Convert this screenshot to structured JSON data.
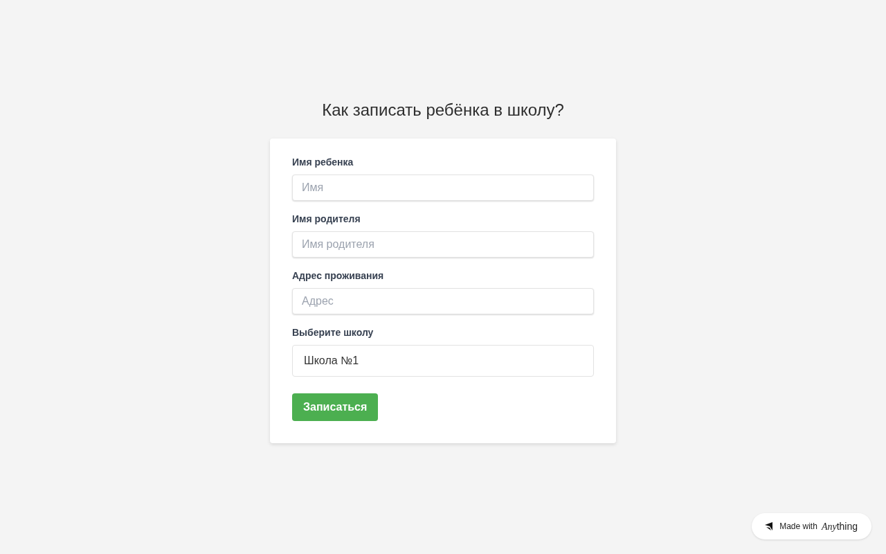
{
  "title": "Как записать ребёнка в школу?",
  "fields": [
    {
      "kind": "text",
      "label": "Имя ребенка",
      "placeholder": "Имя"
    },
    {
      "kind": "text",
      "label": "Имя родителя",
      "placeholder": "Имя родителя"
    },
    {
      "kind": "text",
      "label": "Адрес проживания",
      "placeholder": "Адрес"
    },
    {
      "kind": "select",
      "label": "Выберите школу",
      "value": "Школа №1"
    }
  ],
  "submit": "Записаться",
  "badge": {
    "prefix": "Made with",
    "brand": {
      "italic": "Any",
      "rest": "thing"
    }
  }
}
